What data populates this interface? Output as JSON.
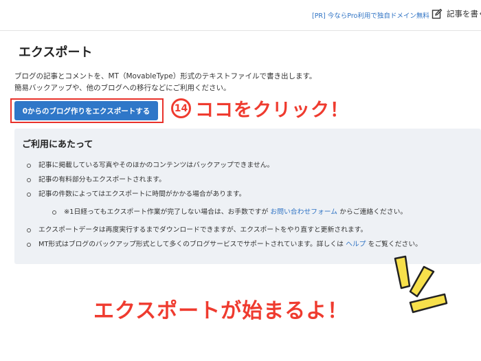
{
  "header": {
    "pr_text": "[PR] 今ならPro利用で独自ドメイン無料",
    "write_label": "記事を書く"
  },
  "page": {
    "title": "エクスポート",
    "description": [
      "ブログの記事とコメントを、MT（MovableType）形式のテキストファイルで書き出します。",
      "簡易バックアップや、他のブログへの移行などにご利用ください。"
    ],
    "export_button": "0からのブログ作りをエクスポートする"
  },
  "annotations": {
    "step_number": "14",
    "step_text": "ココをクリック！",
    "result_text": "エクスポートが始まるよ！"
  },
  "notes": {
    "heading": "ご利用にあたって",
    "items": [
      "記事に掲載している写真やそのほかのコンテンツはバックアップできません。",
      "記事の有料部分もエクスポートされます。",
      "記事の件数によってはエクスポートに時間がかかる場合があります。"
    ],
    "sub_item": {
      "prefix": "※1日経ってもエクスポート作業が完了しない場合は、お手数ですが",
      "link": "お問い合わせフォーム",
      "suffix": "からご連絡ください。"
    },
    "items_after": [
      {
        "text": "エクスポートデータは再度実行するまでダウンロードできますが、エクスポートをやり直すと更新されます。"
      },
      {
        "prefix": "MT形式はブログのバックアップ形式として多くのブログサービスでサポートされています。詳しくは",
        "link": "ヘルプ",
        "suffix": "をご覧ください。"
      }
    ]
  },
  "colors": {
    "accent_blue": "#2f77c8",
    "annotation_red": "#ef3b2f",
    "burst_yellow": "#f7e04b",
    "panel_bg": "#eef1f5"
  },
  "icons": {
    "write": "pencil-square-icon"
  }
}
